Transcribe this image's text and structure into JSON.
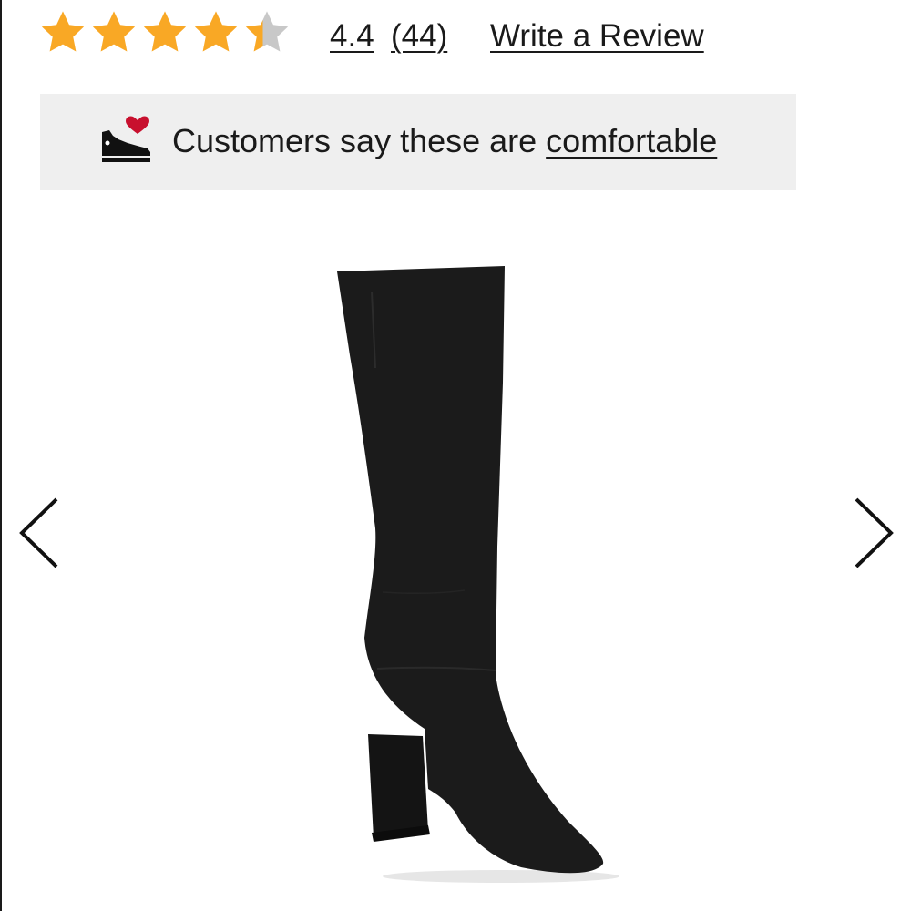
{
  "rating": {
    "stars_total": 5,
    "stars_value": 4.4,
    "value": "4.4",
    "count": "(44)",
    "write_review_label": "Write a Review"
  },
  "comfort_banner": {
    "icon": "shoe-heart-icon",
    "text_prefix": "Customers say these are ",
    "link_text": "comfortable"
  },
  "carousel": {
    "prev_icon": "chevron-left-icon",
    "next_icon": "chevron-right-icon",
    "product_image": "black-suede-knee-high-boot"
  },
  "colors": {
    "star_filled": "#F9A825",
    "star_empty": "#C8C8C8",
    "heart": "#C8102E",
    "banner_bg": "#EFEFEF"
  }
}
